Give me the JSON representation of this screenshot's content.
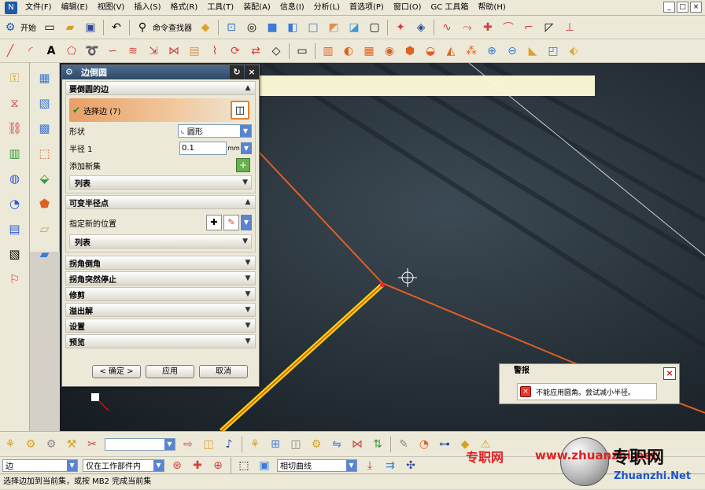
{
  "menu": [
    "文件(F)",
    "编辑(E)",
    "视图(V)",
    "插入(S)",
    "格式(R)",
    "工具(T)",
    "装配(A)",
    "信息(I)",
    "分析(L)",
    "首选项(P)",
    "窗口(O)",
    "GC 工具箱",
    "帮助(H)"
  ],
  "window_buttons": [
    "_",
    "□",
    "×"
  ],
  "toolbar": {
    "start_label": "开始",
    "command_finder_label": "命令查找器"
  },
  "dialog": {
    "title": "边倒圆",
    "reset_glyph": "↻",
    "close_glyph": "×",
    "section_edge": {
      "title": "要倒圆的边",
      "select_edge": "选择边 (7)",
      "shape_label": "形状",
      "shape_value": "圆形",
      "radius_label": "半径 1",
      "radius_value": "0.1",
      "radius_unit": "mm",
      "add_set_label": "添加新集",
      "list_label": "列表"
    },
    "section_variable": {
      "title": "可变半径点",
      "new_pos_label": "指定新的位置",
      "list_label": "列表"
    },
    "collapsed_sections": [
      "拐角倒角",
      "拐角突然停止",
      "修剪",
      "溢出解",
      "设置",
      "预览"
    ],
    "buttons": {
      "ok": "< 确定 >",
      "apply": "应用",
      "cancel": "取消"
    }
  },
  "alarm": {
    "title": "警报",
    "close": "×",
    "error_icon": "×",
    "message": "不能应用圆角。尝试减小半径。"
  },
  "selection_bar": {
    "filter_value": "边",
    "scope_value": "仅在工作部件内",
    "curve_rule": "相切曲线"
  },
  "status": "选择边加到当前集，或按 MB2 完成当前集",
  "watermark": {
    "cn": "专职网",
    "url": "www.zhuanzhi.net",
    "brand": "专职网",
    "domain": "Zhuanzhi.Net"
  },
  "colors": {
    "highlight_edge": "#ffe000",
    "selected_edge": "#e06020",
    "viewport_bg": "#2a343c",
    "banner": "#fffbd8",
    "watermark_red": "#e02020"
  }
}
